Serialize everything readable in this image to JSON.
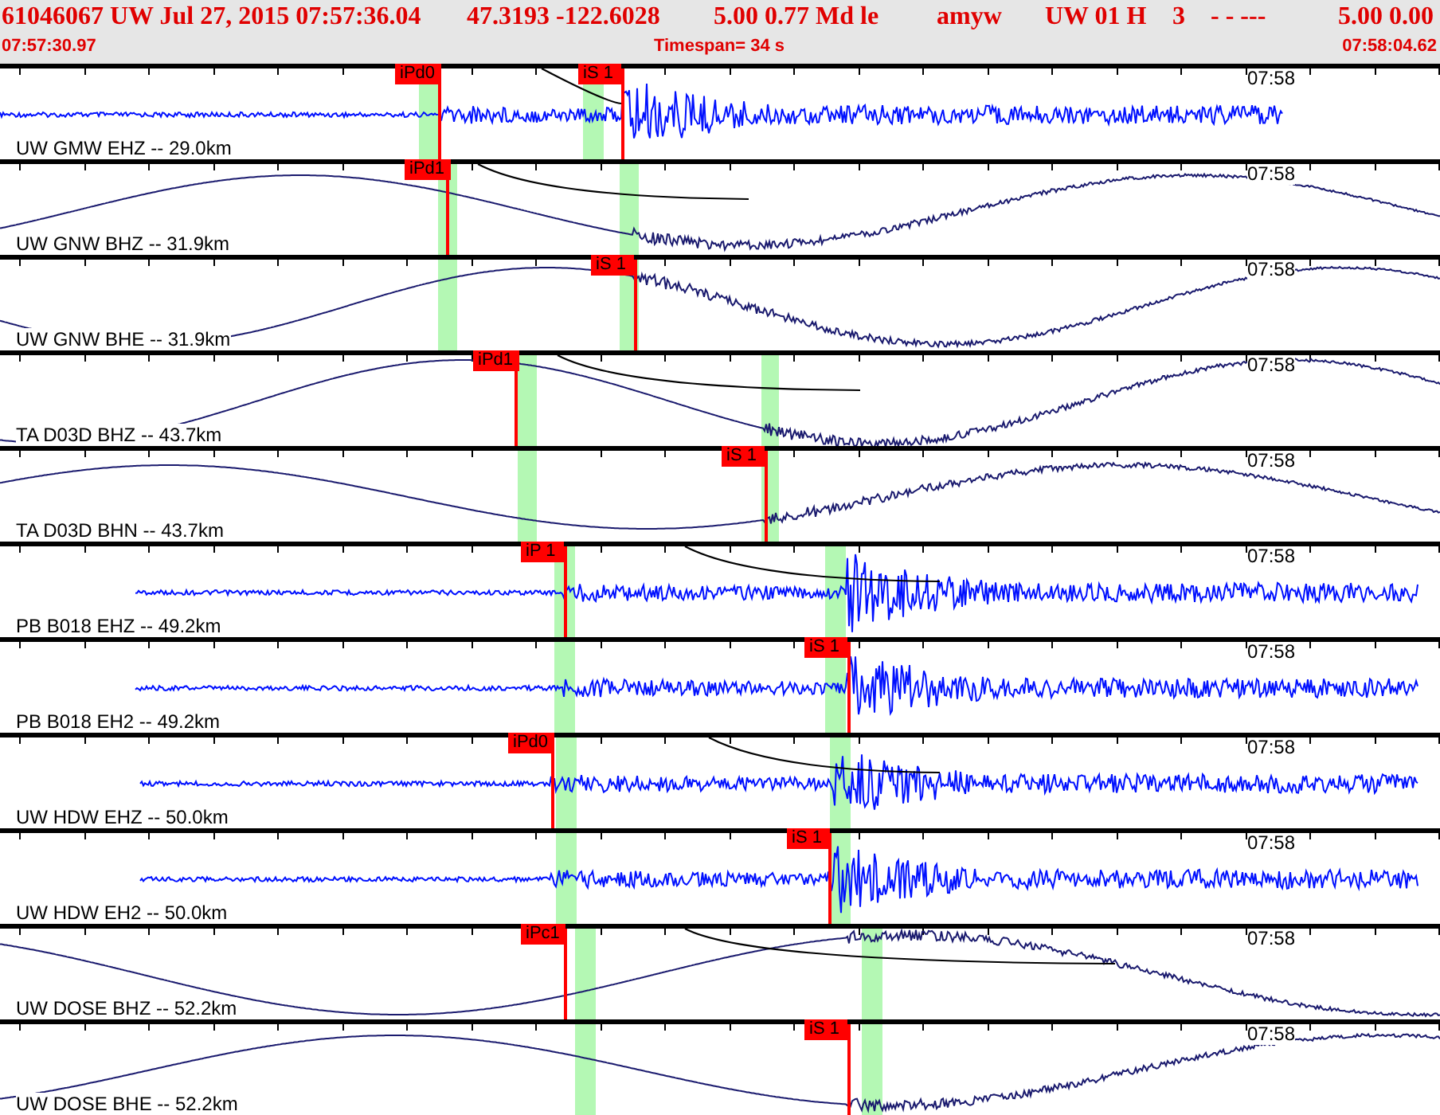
{
  "header": {
    "event": "61046067 UW Jul 27, 2015 07:57:36.04",
    "location": "47.3193 -122.6028",
    "magnitude": "5.00 0.77 Md le",
    "analyst": "amyw",
    "network": "UW 01 H",
    "quality": "3",
    "flags": "- - ---",
    "values": "5.00 0.00",
    "start_time": "07:57:30.97",
    "timespan": "Timespan=  34 s",
    "end_time": "07:58:04.62"
  },
  "traces": [
    {
      "station": "UW GMW EHZ -- 29.0km",
      "time_mark": "07:58",
      "kind": "short-period",
      "picks": [
        {
          "label": "iPd0"
        },
        {
          "label": "iS 1"
        }
      ]
    },
    {
      "station": "UW GNW BHZ -- 31.9km",
      "time_mark": "07:58",
      "kind": "broadband",
      "picks": [
        {
          "label": "iPd1"
        }
      ]
    },
    {
      "station": "UW GNW BHE -- 31.9km",
      "time_mark": "07:58",
      "kind": "broadband",
      "picks": [
        {
          "label": "iS 1"
        }
      ]
    },
    {
      "station": "TA D03D BHZ -- 43.7km",
      "time_mark": "07:58",
      "kind": "broadband",
      "picks": [
        {
          "label": "iPd1"
        }
      ]
    },
    {
      "station": "TA D03D BHN -- 43.7km",
      "time_mark": "07:58",
      "kind": "broadband",
      "picks": [
        {
          "label": "iS 1"
        }
      ]
    },
    {
      "station": "PB B018 EHZ -- 49.2km",
      "time_mark": "07:58",
      "kind": "short-period",
      "picks": [
        {
          "label": "iP 1"
        }
      ]
    },
    {
      "station": "PB B018 EH2 -- 49.2km",
      "time_mark": "07:58",
      "kind": "short-period",
      "picks": [
        {
          "label": "iS 1"
        }
      ]
    },
    {
      "station": "UW HDW EHZ -- 50.0km",
      "time_mark": "07:58",
      "kind": "short-period",
      "picks": [
        {
          "label": "iPd0"
        }
      ]
    },
    {
      "station": "UW HDW EH2 -- 50.0km",
      "time_mark": "07:58",
      "kind": "short-period",
      "picks": [
        {
          "label": "iS 1"
        }
      ]
    },
    {
      "station": "UW DOSE BHZ -- 52.2km",
      "time_mark": "07:58",
      "kind": "broadband",
      "picks": [
        {
          "label": "iPc1"
        }
      ]
    },
    {
      "station": "UW DOSE BHE -- 52.2km",
      "time_mark": "07:58",
      "kind": "broadband",
      "picks": [
        {
          "label": "iS 1"
        }
      ]
    }
  ]
}
